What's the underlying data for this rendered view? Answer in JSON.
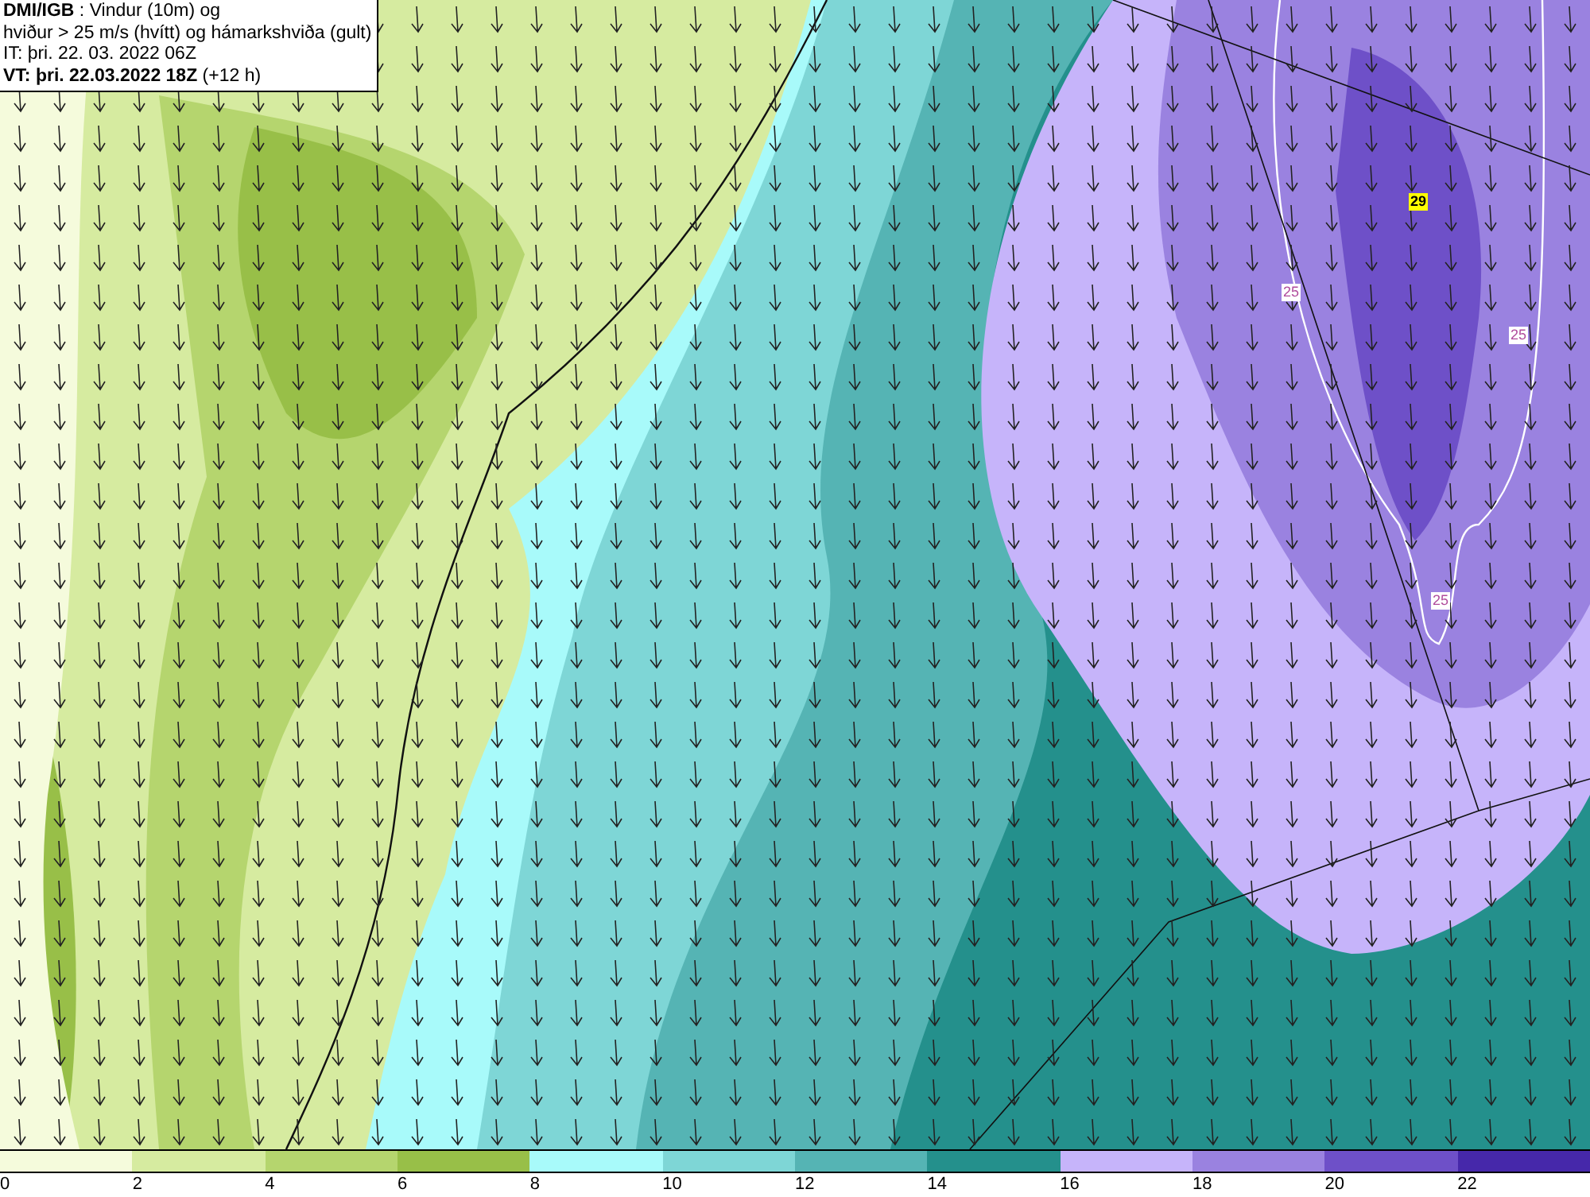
{
  "header": {
    "lines": [
      "**DMI/IGB** : Vindur (10m) og",
      "hviður > 25 m/s (hvítt) og hámarkshviða (gult)",
      "IT: þri. 22. 03. 2022 06Z",
      "**VT: þri. 22.03.2022 18Z** (+12 h)"
    ]
  },
  "contour_labels": [
    {
      "kind": "max",
      "text": "29"
    },
    {
      "kind": "gust",
      "text": "25"
    },
    {
      "kind": "gust",
      "text": "25"
    },
    {
      "kind": "gust",
      "text": "25"
    }
  ],
  "legend": [
    {
      "label": "0",
      "color": "#f5fbdc"
    },
    {
      "label": "2",
      "color": "#d6eba0"
    },
    {
      "label": "4",
      "color": "#b5d56e"
    },
    {
      "label": "6",
      "color": "#98bf48"
    },
    {
      "label": "8",
      "color": "#a8fafa"
    },
    {
      "label": "10",
      "color": "#7ed6d6"
    },
    {
      "label": "12",
      "color": "#55b4b4"
    },
    {
      "label": "14",
      "color": "#24908c"
    },
    {
      "label": "16",
      "color": "#c6b4fa"
    },
    {
      "label": "18",
      "color": "#9a82e0"
    },
    {
      "label": "20",
      "color": "#6e50c8"
    },
    {
      "label": "22",
      "color": "#4628aa"
    }
  ]
}
